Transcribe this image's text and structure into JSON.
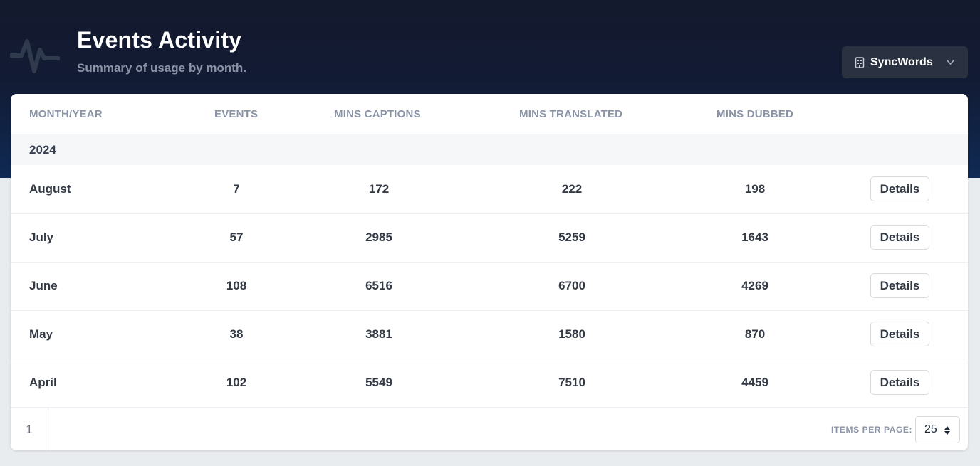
{
  "header": {
    "title": "Events Activity",
    "subtitle": "Summary of usage by month.",
    "icon": "activity-pulse-icon"
  },
  "org_selector": {
    "label": "SyncWords",
    "icon": "building-icon"
  },
  "table": {
    "columns": [
      "MONTH/YEAR",
      "EVENTS",
      "MINS CAPTIONS",
      "MINS TRANSLATED",
      "MINS DUBBED"
    ],
    "group_label": "2024",
    "rows": [
      {
        "month": "August",
        "events": "7",
        "mins_captions": "172",
        "mins_translated": "222",
        "mins_dubbed": "198",
        "action": "Details"
      },
      {
        "month": "July",
        "events": "57",
        "mins_captions": "2985",
        "mins_translated": "5259",
        "mins_dubbed": "1643",
        "action": "Details"
      },
      {
        "month": "June",
        "events": "108",
        "mins_captions": "6516",
        "mins_translated": "6700",
        "mins_dubbed": "4269",
        "action": "Details"
      },
      {
        "month": "May",
        "events": "38",
        "mins_captions": "3881",
        "mins_translated": "1580",
        "mins_dubbed": "870",
        "action": "Details"
      },
      {
        "month": "April",
        "events": "102",
        "mins_captions": "5549",
        "mins_translated": "7510",
        "mins_dubbed": "4459",
        "action": "Details"
      }
    ]
  },
  "pagination": {
    "current_page": "1",
    "items_per_page_label": "ITEMS PER PAGE:",
    "items_per_page": "25"
  },
  "colors": {
    "hero_top": "#141a2d",
    "hero_bottom": "#0f2a54",
    "page_background": "#e9ecef",
    "muted_text": "#8a94a6"
  }
}
